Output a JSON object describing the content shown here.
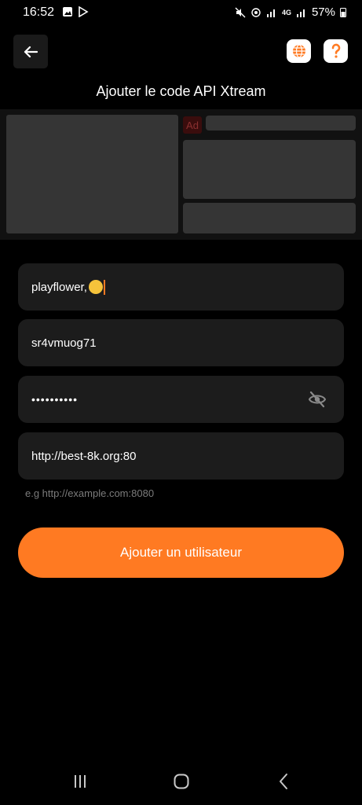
{
  "status": {
    "time": "16:52",
    "network": "4G",
    "battery": "57%"
  },
  "header": {
    "title": "Ajouter le code API Xtream",
    "back_icon": "back-arrow-icon",
    "globe_icon": "globe-icon",
    "help_icon": "help-icon"
  },
  "ad": {
    "badge": "Ad"
  },
  "form": {
    "name_value": "playflower,",
    "username_value": "sr4vmuog71",
    "password_value": "••••••••••",
    "url_value": "http://best-8k.org:80",
    "url_hint": "e.g http://example.com:8080",
    "submit_label": "Ajouter un utilisateur"
  },
  "colors": {
    "accent": "#ff7a22",
    "field_bg": "#1c1c1c",
    "background": "#000000"
  }
}
